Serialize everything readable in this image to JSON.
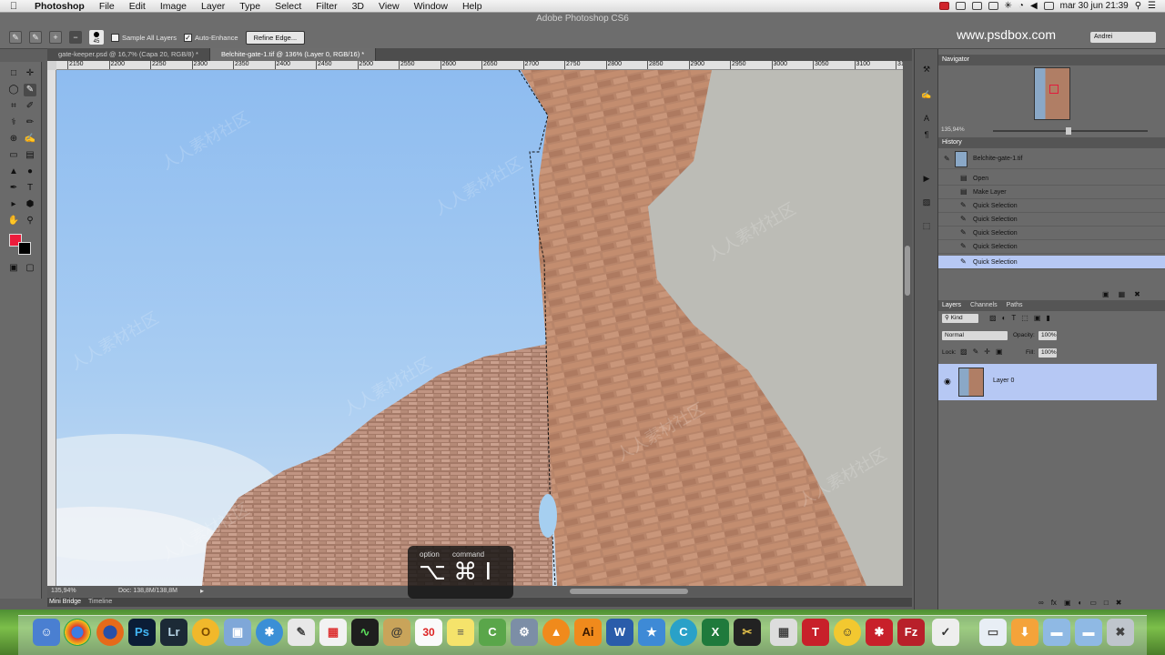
{
  "menubar": {
    "app_name": "Photoshop",
    "items": [
      "File",
      "Edit",
      "Image",
      "Layer",
      "Type",
      "Select",
      "Filter",
      "3D",
      "View",
      "Window",
      "Help"
    ],
    "clock": "mar 30 jun  21:39"
  },
  "window": {
    "title": "Adobe Photoshop CS6"
  },
  "options_bar": {
    "brush_size": "45",
    "sample_all_layers": "Sample All Layers",
    "auto_enhance": "Auto-Enhance",
    "refine_edge": "Refine Edge...",
    "watermark_site": "www.psdbox.com",
    "workspace": "Andrei"
  },
  "document_tabs": [
    {
      "label": "gate-keeper.psd @ 16,7% (Capa 20, RGB/8) *",
      "active": false
    },
    {
      "label": "Belchite-gate-1.tif @ 136% (Layer 0, RGB/16) *",
      "active": true
    }
  ],
  "ruler_ticks": [
    "2150",
    "2200",
    "2250",
    "2300",
    "2350",
    "2400",
    "2450",
    "2500",
    "2550",
    "2600",
    "2650",
    "2700",
    "2750",
    "2800",
    "2850",
    "2900",
    "2950",
    "3000",
    "3050",
    "3100",
    "315"
  ],
  "status_bar": {
    "zoom": "135,94%",
    "doc_size": "Doc: 138,8M/138,8M"
  },
  "mini_bridge": {
    "tabs": [
      "Mini Bridge",
      "Timeline"
    ]
  },
  "key_overlay": {
    "option_label": "option",
    "command_label": "command",
    "keys": "⌥ ⌘ I"
  },
  "navigator": {
    "title": "Navigator",
    "zoom": "135,94%"
  },
  "history": {
    "title": "History",
    "snapshot": "Belchite-gate-1.tif",
    "items": [
      "Open",
      "Make Layer",
      "Quick Selection",
      "Quick Selection",
      "Quick Selection",
      "Quick Selection",
      "Quick Selection"
    ],
    "selected_index": 6
  },
  "layers": {
    "tabs": [
      "Layers",
      "Channels",
      "Paths"
    ],
    "filter": "Kind",
    "blend_mode": "Normal",
    "opacity_label": "Opacity:",
    "opacity": "100%",
    "lock_label": "Lock:",
    "fill_label": "Fill:",
    "fill": "100%",
    "layer_name": "Layer 0"
  },
  "colors": {
    "foreground": "#ec1c3b",
    "background": "#000000",
    "selection": "#b6c8f4"
  },
  "dock": {
    "ps_label": "Ps",
    "lr_label": "Lr",
    "calendar_day": "30"
  }
}
